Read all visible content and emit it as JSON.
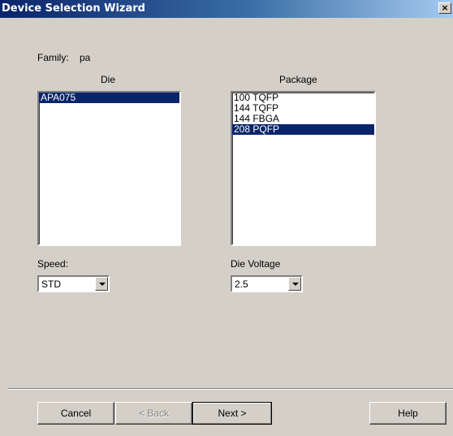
{
  "window": {
    "title": "Device Selection Wizard",
    "close_glyph": "×"
  },
  "family": {
    "label": "Family:",
    "value": "pa"
  },
  "die": {
    "header": "Die",
    "items": [
      "APA075"
    ],
    "selected": "APA075"
  },
  "package": {
    "header": "Package",
    "items": [
      "100 TQFP",
      "144 TQFP",
      "144 FBGA",
      "208 PQFP"
    ],
    "selected": "208 PQFP"
  },
  "speed": {
    "label": "Speed:",
    "value": "STD"
  },
  "die_voltage": {
    "label": "Die Voltage",
    "value": "2.5"
  },
  "buttons": {
    "cancel": "Cancel",
    "back": "< Back",
    "next": "Next >",
    "help": "Help"
  }
}
